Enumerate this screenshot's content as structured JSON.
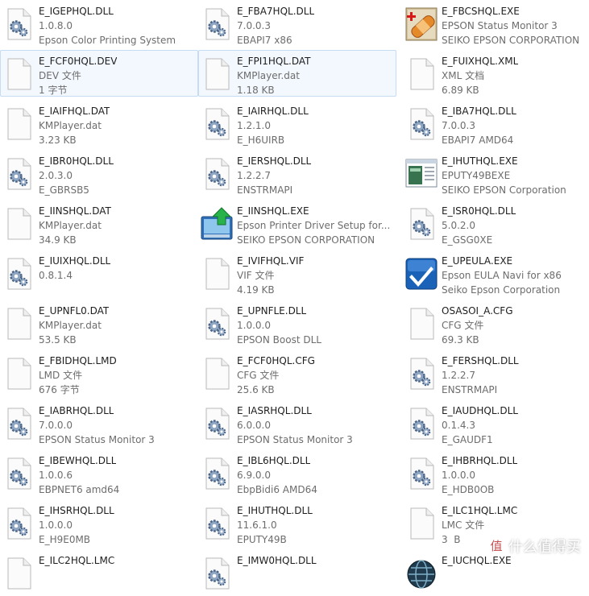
{
  "files": [
    {
      "name": "E_IGEPHQL.DLL",
      "line2": "1.0.8.0",
      "line3": "Epson Color Printing System",
      "icon": "dll-gear-icon"
    },
    {
      "name": "E_FBA7HQL.DLL",
      "line2": "7.0.0.3",
      "line3": "EBAPI7 x86",
      "icon": "dll-gear-icon"
    },
    {
      "name": "E_FBCSHQL.EXE",
      "line2": "EPSON Status Monitor 3",
      "line3": "SEIKO EPSON CORPORATION",
      "icon": "status-monitor-bandage-icon"
    },
    {
      "name": "E_FCF0HQL.DEV",
      "line2": "DEV 文件",
      "line3": "1 字节",
      "icon": "blank-file-icon",
      "selected": true
    },
    {
      "name": "E_FPI1HQL.DAT",
      "line2": "KMPlayer.dat",
      "line3": "1.18 KB",
      "icon": "blank-file-icon",
      "selected": true
    },
    {
      "name": "E_FUIXHQL.XML",
      "line2": "XML 文档",
      "line3": "6.89 KB",
      "icon": "blank-file-icon"
    },
    {
      "name": "E_IAIFHQL.DAT",
      "line2": "KMPlayer.dat",
      "line3": "3.23 KB",
      "icon": "blank-file-icon"
    },
    {
      "name": "E_IAIRHQL.DLL",
      "line2": "1.2.1.0",
      "line3": "E_H6UIRB",
      "icon": "dll-gear-icon"
    },
    {
      "name": "E_IBA7HQL.DLL",
      "line2": "7.0.0.3",
      "line3": "EBAPI7 AMD64",
      "icon": "dll-gear-icon"
    },
    {
      "name": "E_IBR0HQL.DLL",
      "line2": "2.0.3.0",
      "line3": "E_GBRSB5",
      "icon": "dll-gear-icon"
    },
    {
      "name": "E_IERSHQL.DLL",
      "line2": "1.2.2.7",
      "line3": "ENSTRMAPI",
      "icon": "dll-gear-icon"
    },
    {
      "name": "E_IHUTHQL.EXE",
      "line2": "EPUTY49BEXE",
      "line3": "SEIKO EPSON Corporation",
      "icon": "utility-window-icon"
    },
    {
      "name": "E_IINSHQL.DAT",
      "line2": "KMPlayer.dat",
      "line3": "34.9 KB",
      "icon": "blank-file-icon"
    },
    {
      "name": "E_IINSHQL.EXE",
      "line2": "Epson Printer Driver Setup for...",
      "line3": "SEIKO EPSON CORPORATION",
      "icon": "installer-arrow-icon"
    },
    {
      "name": "E_ISR0HQL.DLL",
      "line2": "5.0.2.0",
      "line3": "E_GSG0XE",
      "icon": "dll-gear-icon"
    },
    {
      "name": "E_IUIXHQL.DLL",
      "line2": "0.8.1.4",
      "line3": "",
      "icon": "dll-gear-icon"
    },
    {
      "name": "E_IVIFHQL.VIF",
      "line2": "VIF 文件",
      "line3": "4.19 KB",
      "icon": "blank-file-icon"
    },
    {
      "name": "E_UPEULA.EXE",
      "line2": "Epson EULA Navi for x86",
      "line3": "Seiko Epson Corporation",
      "icon": "checkmark-app-icon"
    },
    {
      "name": "E_UPNFL0.DAT",
      "line2": "KMPlayer.dat",
      "line3": "53.5 KB",
      "icon": "blank-file-icon"
    },
    {
      "name": "E_UPNFLE.DLL",
      "line2": "1.0.0.0",
      "line3": "EPSON Boost DLL",
      "icon": "dll-gear-icon"
    },
    {
      "name": "OSASOI_A.CFG",
      "line2": "CFG 文件",
      "line3": "69.3 KB",
      "icon": "blank-file-icon"
    },
    {
      "name": "E_FBIDHQL.LMD",
      "line2": "LMD 文件",
      "line3": "676 字节",
      "icon": "blank-file-icon"
    },
    {
      "name": "E_FCF0HQL.CFG",
      "line2": "CFG 文件",
      "line3": "25.6 KB",
      "icon": "blank-file-icon"
    },
    {
      "name": "E_FERSHQL.DLL",
      "line2": "1.2.2.7",
      "line3": "ENSTRMAPI",
      "icon": "dll-gear-icon"
    },
    {
      "name": "E_IABRHQL.DLL",
      "line2": "7.0.0.0",
      "line3": "EPSON Status Monitor 3",
      "icon": "dll-gear-icon"
    },
    {
      "name": "E_IASRHQL.DLL",
      "line2": "6.0.0.0",
      "line3": "EPSON Status Monitor 3",
      "icon": "dll-gear-icon"
    },
    {
      "name": "E_IAUDHQL.DLL",
      "line2": "0.1.4.3",
      "line3": "E_GAUDF1",
      "icon": "dll-gear-icon"
    },
    {
      "name": "E_IBEWHQL.DLL",
      "line2": "1.0.0.6",
      "line3": "EBPNET6 amd64",
      "icon": "dll-gear-icon"
    },
    {
      "name": "E_IBL6HQL.DLL",
      "line2": "6.9.0.0",
      "line3": "EbpBidi6 AMD64",
      "icon": "dll-gear-icon"
    },
    {
      "name": "E_IHBRHQL.DLL",
      "line2": "1.0.0.0",
      "line3": "E_HDB0OB",
      "icon": "dll-gear-icon"
    },
    {
      "name": "E_IHSRHQL.DLL",
      "line2": "1.0.0.0",
      "line3": "E_H9E0MB",
      "icon": "dll-gear-icon"
    },
    {
      "name": "E_IHUTHQL.DLL",
      "line2": "11.6.1.0",
      "line3": "EPUTY49B",
      "icon": "dll-gear-icon"
    },
    {
      "name": "E_ILC1HQL.LMC",
      "line2": "LMC 文件",
      "line3": "3  B",
      "icon": "blank-file-icon"
    },
    {
      "name": "E_ILC2HQL.LMC",
      "line2": "",
      "line3": "",
      "icon": "blank-file-icon"
    },
    {
      "name": "E_IMW0HQL.DLL",
      "line2": "",
      "line3": "",
      "icon": "dll-gear-icon"
    },
    {
      "name": "E_IUCHQL.EXE",
      "line2": "",
      "line3": "",
      "icon": "globe-app-icon"
    }
  ],
  "watermark": {
    "text": "什么值得买",
    "badge": "值"
  }
}
